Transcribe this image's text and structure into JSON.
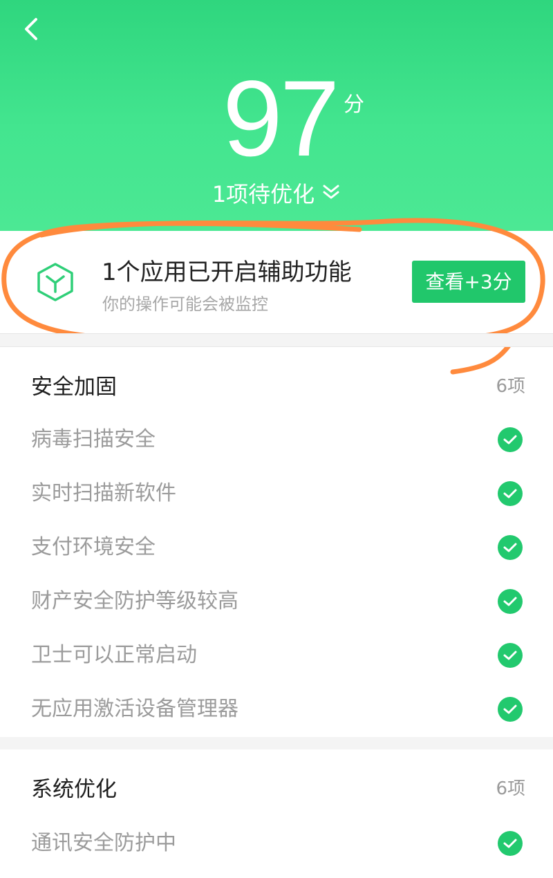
{
  "header": {
    "score": "97",
    "score_unit": "分",
    "pending_text": "1项待优化",
    "back_icon": "chevron-left-icon",
    "expand_icon": "double-chevron-down-icon",
    "bg_color": "#3de08a"
  },
  "alert": {
    "icon": "cube-icon",
    "title": "1个应用已开启辅助功能",
    "subtitle": "你的操作可能会被监控",
    "button_label": "查看+3分",
    "button_color": "#21c76b",
    "annotation_color": "#ff8a3d"
  },
  "sections": [
    {
      "title": "安全加固",
      "count": "6项",
      "items": [
        {
          "label": "病毒扫描安全",
          "status_icon": "check-circle-icon"
        },
        {
          "label": "实时扫描新软件",
          "status_icon": "check-circle-icon"
        },
        {
          "label": "支付环境安全",
          "status_icon": "check-circle-icon"
        },
        {
          "label": "财产安全防护等级较高",
          "status_icon": "check-circle-icon"
        },
        {
          "label": "卫士可以正常启动",
          "status_icon": "check-circle-icon"
        },
        {
          "label": "无应用激活设备管理器",
          "status_icon": "check-circle-icon"
        }
      ]
    },
    {
      "title": "系统优化",
      "count": "6项",
      "items": [
        {
          "label": "通讯安全防护中",
          "status_icon": "check-circle-icon"
        }
      ]
    }
  ]
}
